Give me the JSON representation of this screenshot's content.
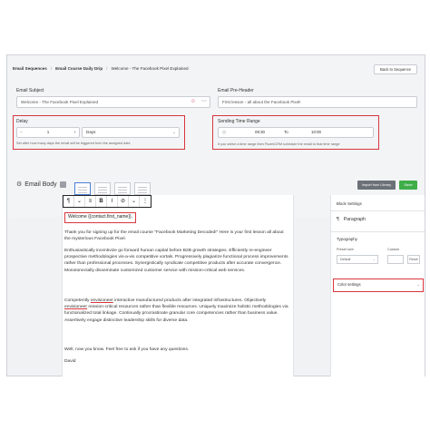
{
  "breadcrumb": {
    "items": [
      "Email Sequences",
      "Email Course Daily Drip",
      "Welcome - The Facebook Pixel Explained"
    ],
    "separator": "/"
  },
  "back_button": "Back to Sequence",
  "subject": {
    "label": "Email Subject",
    "value": "Welcome - The Facebook Pixel Explained",
    "icons": [
      "emoji-icon",
      "more-icon"
    ]
  },
  "preheader": {
    "label": "Email Pre-Header",
    "value": "First lesson - all about the Facebook Pixel!"
  },
  "delay": {
    "label": "Delay",
    "minus": "−",
    "value": "1",
    "plus": "+",
    "unit": "Days",
    "hint": "Set after how many days the email will be triggered from the assigned date"
  },
  "sending_time": {
    "label": "Sending Time Range",
    "from": "09:30",
    "to_label": "To",
    "to": "10:00",
    "hint": "If you select a time range then FluentCRM schedule the email to that time range"
  },
  "email_body": {
    "label": "Email Body"
  },
  "actions": {
    "import": "Import from Library",
    "save": "Save"
  },
  "toolbar": [
    "¶",
    "⌄",
    "≡",
    "B",
    "I",
    "⊘",
    "⌄",
    "⋮"
  ],
  "content": {
    "greeting": "Welcome {{contact.first_name}},",
    "p1": "Thank you for signing up for the email course \"Facebook Marketing Decoded!\" Here is your first lesson all about the mysterious Facebook Pixel.",
    "p2": "Enthusiastically incentivize go forward human capital before B2B growth strategies. Efficiently re-engineer prospective methodologies vis-a-vis competitive vortals. Progressively plagiarize functional process improvements rather than professional processes. Synergistically syndicate competitive products after accurate convergence. Monotonectally disseminate customized customer service with mission-critical web services.",
    "p3a": "Competently ",
    "p3u1": "envisioneer",
    "p3b": " interactive manufactured products after integrated infrastructures. Objectively ",
    "p3u2": "envisioneer",
    "p3c": " mission-critical resources rather than flexible resources. Uniquely maximize holistic methodologies via functionalized total linkage. Continually procrastinate granular core competencies rather than business value. Assertively engage distinctive leadership skills for diverse data.",
    "p4": "Well, now you know.  Feel free to ask if you have any questions.",
    "sign": "David"
  },
  "sidebar": {
    "block_settings": "Block Settings",
    "paragraph": "Paragraph",
    "paragraph_icon": "¶",
    "typography": "Typography",
    "preset_label": "Preset size",
    "custom_label": "Custom",
    "preset_value": "Default",
    "reset": "Reset",
    "color_settings": "Color settings"
  }
}
